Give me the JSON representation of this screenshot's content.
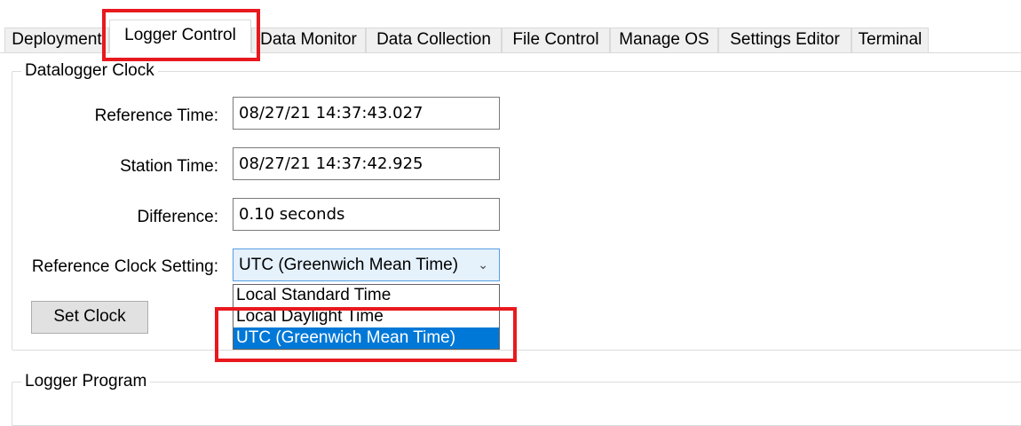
{
  "tabs": [
    {
      "label": "Deployment"
    },
    {
      "label": "Logger Control",
      "active": true
    },
    {
      "label": "Data Monitor"
    },
    {
      "label": "Data Collection"
    },
    {
      "label": "File Control"
    },
    {
      "label": "Manage OS"
    },
    {
      "label": "Settings Editor"
    },
    {
      "label": "Terminal"
    }
  ],
  "clock": {
    "legend": "Datalogger Clock",
    "reference_time_label": "Reference Time:",
    "reference_time_value": "08/27/21 14:37:43.027",
    "station_time_label": "Station Time:",
    "station_time_value": "08/27/21 14:37:42.925",
    "difference_label": "Difference:",
    "difference_value": "0.10 seconds",
    "ref_clock_label": "Reference Clock Setting:",
    "ref_clock_value": "UTC (Greenwich Mean Time)",
    "options": [
      "Local Standard Time",
      "Local Daylight Time",
      "UTC (Greenwich Mean Time)"
    ],
    "set_clock_label": "Set Clock"
  },
  "program": {
    "legend": "Logger Program"
  },
  "colors": {
    "highlight": "#e8191e",
    "selection": "#0078d7",
    "combo_focus": "#e5f1fb"
  }
}
